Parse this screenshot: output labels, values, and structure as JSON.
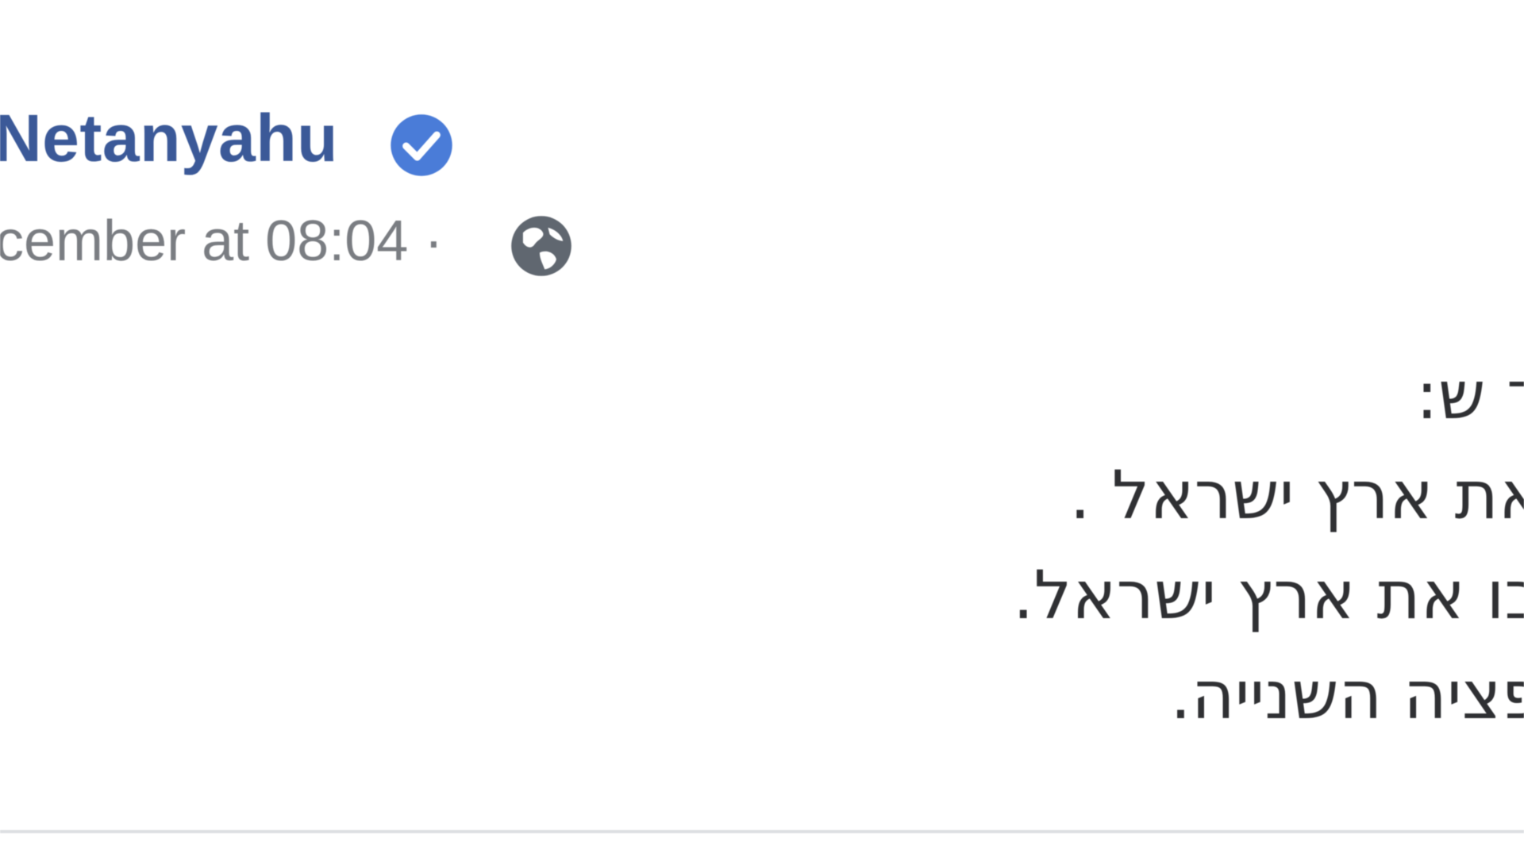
{
  "post": {
    "author_name": "Netanyahu",
    "timestamp": "cember at 08:04 ·",
    "lines": [
      "ד ש:",
      "את ארץ ישראל .",
      "בו את ארץ ישראל.",
      "פציה השנייה."
    ]
  },
  "icons": {
    "verified": "verified-badge-icon",
    "audience": "globe-icon"
  },
  "colors": {
    "author_name": "#3b5998",
    "verified_badge": "#4a7cd8",
    "meta_text": "#7a7d82",
    "post_text": "#2f3033",
    "divider": "#dddfe2"
  }
}
